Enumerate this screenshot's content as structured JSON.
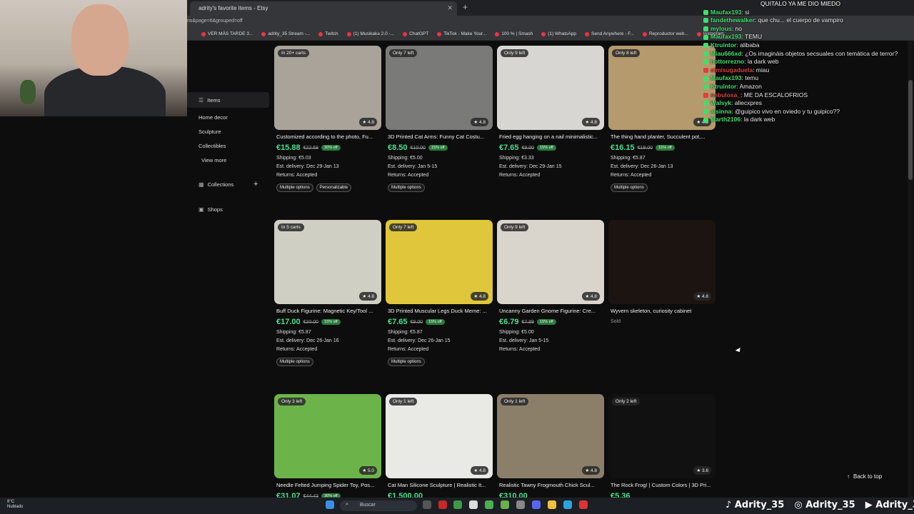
{
  "browser": {
    "tab_title": "adrity's favorite items - Etsy",
    "url": "ns&page=6&grouped=off",
    "bookmarks": [
      "VER MÁS TARDE 3...",
      "adrity_35 Stream -...",
      "Twitch",
      "(1) Musikaka 2.0 -...",
      "ChatGPT",
      "TikTok - Make Your...",
      "100 % | Smash",
      "(1) WhatsApp",
      "Send Anywhere - F...",
      "Reproductor web...",
      "Instagram"
    ]
  },
  "sidebar": {
    "items": [
      {
        "label": "Items",
        "icon": "list-icon"
      },
      {
        "label": "Home decor"
      },
      {
        "label": "Sculpture"
      },
      {
        "label": "Collectibles"
      },
      {
        "label": "View more"
      },
      {
        "label": "Collections",
        "icon": "grid-icon",
        "action": "+"
      },
      {
        "label": "Shops",
        "icon": "shop-icon"
      }
    ]
  },
  "products": [
    {
      "badge": "In 20+ carts",
      "rating": "★ 4.8",
      "title": "Customized according to the photo, Fu...",
      "price": "€15.88",
      "old": "€22.68",
      "off": "30% off",
      "shipping": "€5.03",
      "delivery": "Dec 29-Jan 13",
      "returns": "Accepted",
      "chips": [
        "Multiple options",
        "Personalizable"
      ],
      "color": "#a9a39a"
    },
    {
      "badge": "Only 7 left",
      "rating": "★ 4.8",
      "title": "3D Printed Cat Arms: Funny Cat Costu...",
      "price": "€8.50",
      "old": "€10.00",
      "off": "15% off",
      "shipping": "€5.00",
      "delivery": "Jan 5-15",
      "returns": "Accepted",
      "chips": [
        "Multiple options"
      ],
      "color": "#7a7a78"
    },
    {
      "badge": "Only 9 left",
      "rating": "★ 4.8",
      "title": "Fried egg hanging on a nail minimalistic...",
      "price": "€7.65",
      "old": "€9.00",
      "off": "15% off",
      "shipping": "€3.33",
      "delivery": "Dec 29-Jan 15",
      "returns": "Accepted",
      "chips": [],
      "color": "#d8d6d2"
    },
    {
      "badge": "Only 8 left",
      "rating": "★ 4.8",
      "title": "The thing hand planter, Succulent pot,...",
      "price": "€16.15",
      "old": "€19.00",
      "off": "15% off",
      "shipping": "€5.87",
      "delivery": "Dec 26-Jan 13",
      "returns": "Accepted",
      "chips": [
        "Multiple options"
      ],
      "color": "#b49a6c"
    },
    {
      "badge": "In 5 carts",
      "rating": "★ 4.8",
      "title": "Buff Duck Figurine: Magnetic Key/Tool ...",
      "price": "€17.00",
      "old": "€20.00",
      "off": "15% off",
      "shipping": "€5.87",
      "delivery": "Dec 26-Jan 16",
      "returns": "Accepted",
      "chips": [
        "Multiple options"
      ],
      "color": "#cfcfc4"
    },
    {
      "badge": "Only 7 left",
      "rating": "★ 4.8",
      "title": "3D Printed Muscular Legs Duck Meme: ...",
      "price": "€7.65",
      "old": "€9.00",
      "off": "15% off",
      "shipping": "€5.87",
      "delivery": "Dec 26-Jan 15",
      "returns": "Accepted",
      "chips": [
        "Multiple options"
      ],
      "color": "#e0c63a"
    },
    {
      "badge": "Only 9 left",
      "rating": "★ 4.8",
      "title": "Uncanny Garden Gnome Figurine: Cre...",
      "price": "€6.79",
      "old": "€7.99",
      "off": "15% off",
      "shipping": "€5.00",
      "delivery": "Jan 5-15",
      "returns": "Accepted",
      "chips": [],
      "color": "#d9d4cc"
    },
    {
      "badge": "",
      "rating": "★ 4.8",
      "title": "Wyvern skeleton, curiosity cabinet",
      "sold": "Sold",
      "chips": [],
      "color": "#1b1410"
    },
    {
      "badge": "Only 3 left",
      "rating": "★ 5.0",
      "title": "Needle Felted Jumping Spider Toy, Pos...",
      "price": "€31.07",
      "old": "€44.43",
      "off": "30% off",
      "chips": [],
      "color": "#6cb44a"
    },
    {
      "badge": "Only 1 left",
      "rating": "★ 4.8",
      "title": "Cat Man Silicone Sculpture | Realistic It...",
      "price": "€1,500.00",
      "chips": [],
      "color": "#e9e9e6"
    },
    {
      "badge": "Only 1 left",
      "rating": "★ 4.8",
      "title": "Realistic Tawny Frogmouth Chick Scul...",
      "price": "€310.00",
      "chips": [],
      "color": "#8b7f6a"
    },
    {
      "badge": "Only 2 left",
      "rating": "★ 3.6",
      "title": "The Rock Frog! | Custom Colors | 3D Pri...",
      "price": "€5.36",
      "chips": [],
      "color": "#111111"
    }
  ],
  "labels": {
    "shipping": "Shipping:",
    "delivery": "Est. delivery:",
    "returns": "Returns:",
    "back_to_top": "Back to top"
  },
  "chat": [
    {
      "user": "Maufax193",
      "text": "si",
      "color": "#3ee06a"
    },
    {
      "user": "fandethewalker",
      "text": "que chu... el cuerpo de vampiro",
      "color": "#3ee06a"
    },
    {
      "user": "mylous",
      "text": "no",
      "color": "#3ee06a"
    },
    {
      "user": "Maufax193",
      "text": "TEMU",
      "color": "#3ee06a"
    },
    {
      "user": "Ktruintor",
      "text": "alibaba",
      "color": "#3ee06a"
    },
    {
      "user": "Miau666xd",
      "text": "¿Os imagináis objetos secsuales con temática de terror?",
      "color": "#3ee06a"
    },
    {
      "user": "hottorrezno",
      "text": "la dark web",
      "color": "#3ee06a"
    },
    {
      "user": "elmisugaduela",
      "text": "miau",
      "color": "#e03e3e"
    },
    {
      "user": "Maufax193",
      "text": "temu",
      "color": "#3ee06a"
    },
    {
      "user": "Ktruintor",
      "text": "Amazon",
      "color": "#3ee06a"
    },
    {
      "user": "nebulosa_",
      "text": "ME DA ESCALOFRIOS",
      "color": "#e03e3e"
    },
    {
      "user": "Walsyk",
      "text": "aliecxpres",
      "color": "#3ee06a"
    },
    {
      "user": "alsinna",
      "text": "@guipico vivo en oviedo y tu guipico??",
      "color": "#3ee06a"
    },
    {
      "user": "Marth2106",
      "text": "la dark web",
      "color": "#3ee06a"
    }
  ],
  "chat_overlay_top": "QUITALO YA ME DIO MIEDO",
  "taskbar": {
    "weather_temp": "8°C",
    "weather_desc": "Nublado",
    "search_placeholder": "Buscar",
    "socials": [
      "Adrity_35",
      "Adrity_35",
      "Adrity_35"
    ]
  }
}
